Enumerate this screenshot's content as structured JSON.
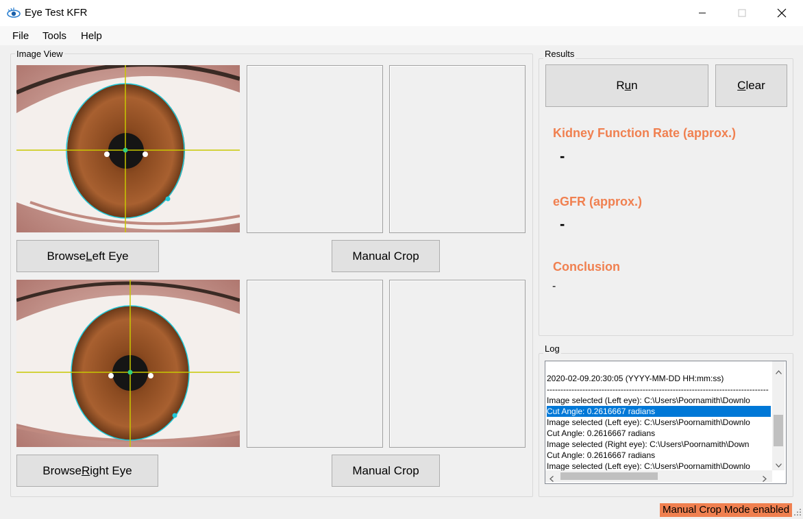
{
  "window": {
    "title": "Eye Test KFR"
  },
  "menu": {
    "items": [
      "File",
      "Tools",
      "Help"
    ]
  },
  "image_view": {
    "label": "Image View",
    "browse_left": {
      "pre": "Browse ",
      "key": "L",
      "post": "eft Eye"
    },
    "browse_right": {
      "pre": "Browse ",
      "key": "R",
      "post": "ight Eye"
    },
    "manual_crop_top": "Manual Crop",
    "manual_crop_bottom": "Manual Crop"
  },
  "results": {
    "label": "Results",
    "run": {
      "pre": "R",
      "key": "u",
      "post": "n"
    },
    "clear": {
      "pre": "",
      "key": "C",
      "post": "lear"
    },
    "kfr_label": "Kidney Function Rate (approx.)",
    "kfr_value": "-",
    "egfr_label": "eGFR (approx.)",
    "egfr_value": "-",
    "conclusion_label": "Conclusion",
    "conclusion_value": "-"
  },
  "log": {
    "label": "Log",
    "lines": [
      "2020-02-09.20:30:05 (YYYY-MM-DD  HH:mm:ss)",
      "---------------------------------------------------------------------------------",
      "Image selected (Left eye): C:\\Users\\Poornamith\\Downlo",
      "Cut Angle: 0.2616667 radians",
      "Image selected (Left eye): C:\\Users\\Poornamith\\Downlo",
      "Cut Angle: 0.2616667 radians",
      "Image selected (Right eye): C:\\Users\\Poornamith\\Down",
      "Cut Angle: 0.2616667 radians",
      "Image selected (Left eye): C:\\Users\\Poornamith\\Downlo"
    ],
    "selected_index": 3
  },
  "status": {
    "text": "Manual Crop Mode enabled"
  },
  "colors": {
    "accent": "#f08050",
    "selection": "#0078d7",
    "overlay_circle": "#20c8d8",
    "crosshair": "#c8c800"
  }
}
